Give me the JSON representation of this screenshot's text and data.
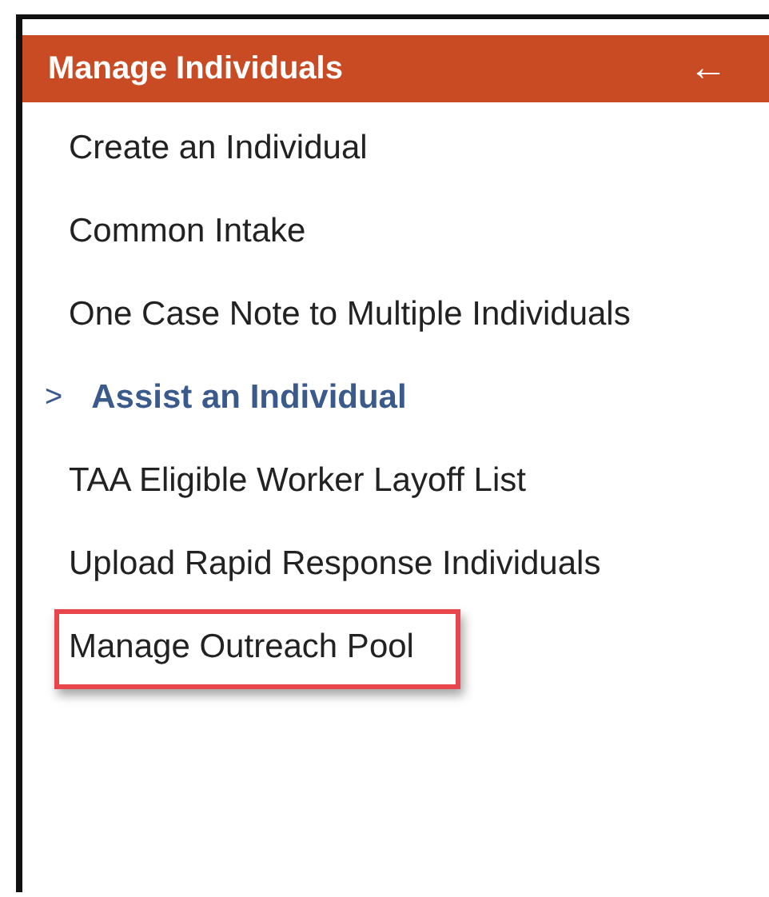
{
  "panel": {
    "title": "Manage Individuals",
    "back_icon": "←"
  },
  "menu": [
    {
      "kind": "link",
      "label": "Create an Individual",
      "highlighted": false
    },
    {
      "kind": "link",
      "label": "Common Intake",
      "highlighted": false
    },
    {
      "kind": "link",
      "label": "One Case Note to Multiple Individuals",
      "highlighted": false
    },
    {
      "kind": "group",
      "label": "Assist an Individual",
      "expanded": false,
      "chevron": ">"
    },
    {
      "kind": "link",
      "label": "TAA Eligible Worker Layoff List",
      "highlighted": false
    },
    {
      "kind": "link",
      "label": "Upload Rapid Response Individuals",
      "highlighted": false
    },
    {
      "kind": "link",
      "label": "Manage Outreach Pool",
      "highlighted": true
    }
  ]
}
